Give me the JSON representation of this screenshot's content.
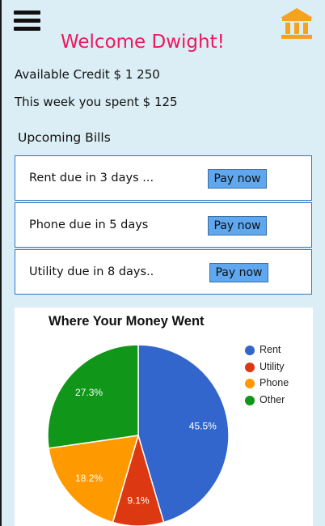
{
  "header": {
    "menu_icon": "hamburger-menu-icon",
    "bank_icon": "bank-icon",
    "welcome": "Welcome Dwight!",
    "welcome_color": "#ee1760",
    "bank_icon_color": "#f5a31c"
  },
  "summary": {
    "credit": "Available Credit $ 1 250",
    "spent": "This week you spent $ 125"
  },
  "bills": {
    "title": "Upcoming Bills",
    "items": [
      {
        "label": "Rent due in 3 days ...",
        "button": "Pay now"
      },
      {
        "label": "Phone due in 5 days",
        "button": "Pay now"
      },
      {
        "label": "Utility due in 8 days..",
        "button": "Pay now"
      }
    ]
  },
  "chart_data": {
    "type": "pie",
    "title": "Where Your Money Went",
    "slices": [
      {
        "name": "Rent",
        "value": 45.5,
        "label": "45.5%",
        "color": "#3366cc"
      },
      {
        "name": "Utility",
        "value": 9.1,
        "label": "9.1%",
        "color": "#dc3912"
      },
      {
        "name": "Phone",
        "value": 18.2,
        "label": "18.2%",
        "color": "#ff9900"
      },
      {
        "name": "Other",
        "value": 27.3,
        "label": "27.3%",
        "color": "#109618"
      }
    ],
    "legend_position": "right"
  }
}
